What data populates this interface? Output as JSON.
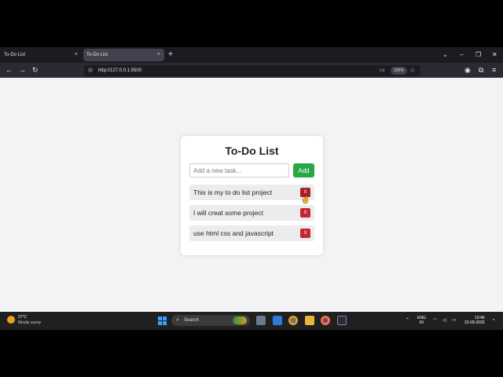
{
  "browser": {
    "tabs": [
      {
        "title": "To-Do List",
        "close": "×"
      },
      {
        "title": "To-Do List",
        "close": "×"
      }
    ],
    "new_tab": "+",
    "url": "http://127.0.0.1:5500",
    "zoom": "120%"
  },
  "app": {
    "title": "To-Do List",
    "input_placeholder": "Add a new task...",
    "add_label": "Add",
    "delete_label": "X",
    "tasks": [
      "This is my to do list project",
      "I will creat some project",
      "use html css and javascript"
    ]
  },
  "taskbar": {
    "weather_temp": "27°C",
    "weather_cond": "Mostly sunny",
    "search_label": "Search",
    "lang_line1": "ENG",
    "lang_line2": "IN",
    "time": "10:46",
    "date": "23-09-2026"
  }
}
